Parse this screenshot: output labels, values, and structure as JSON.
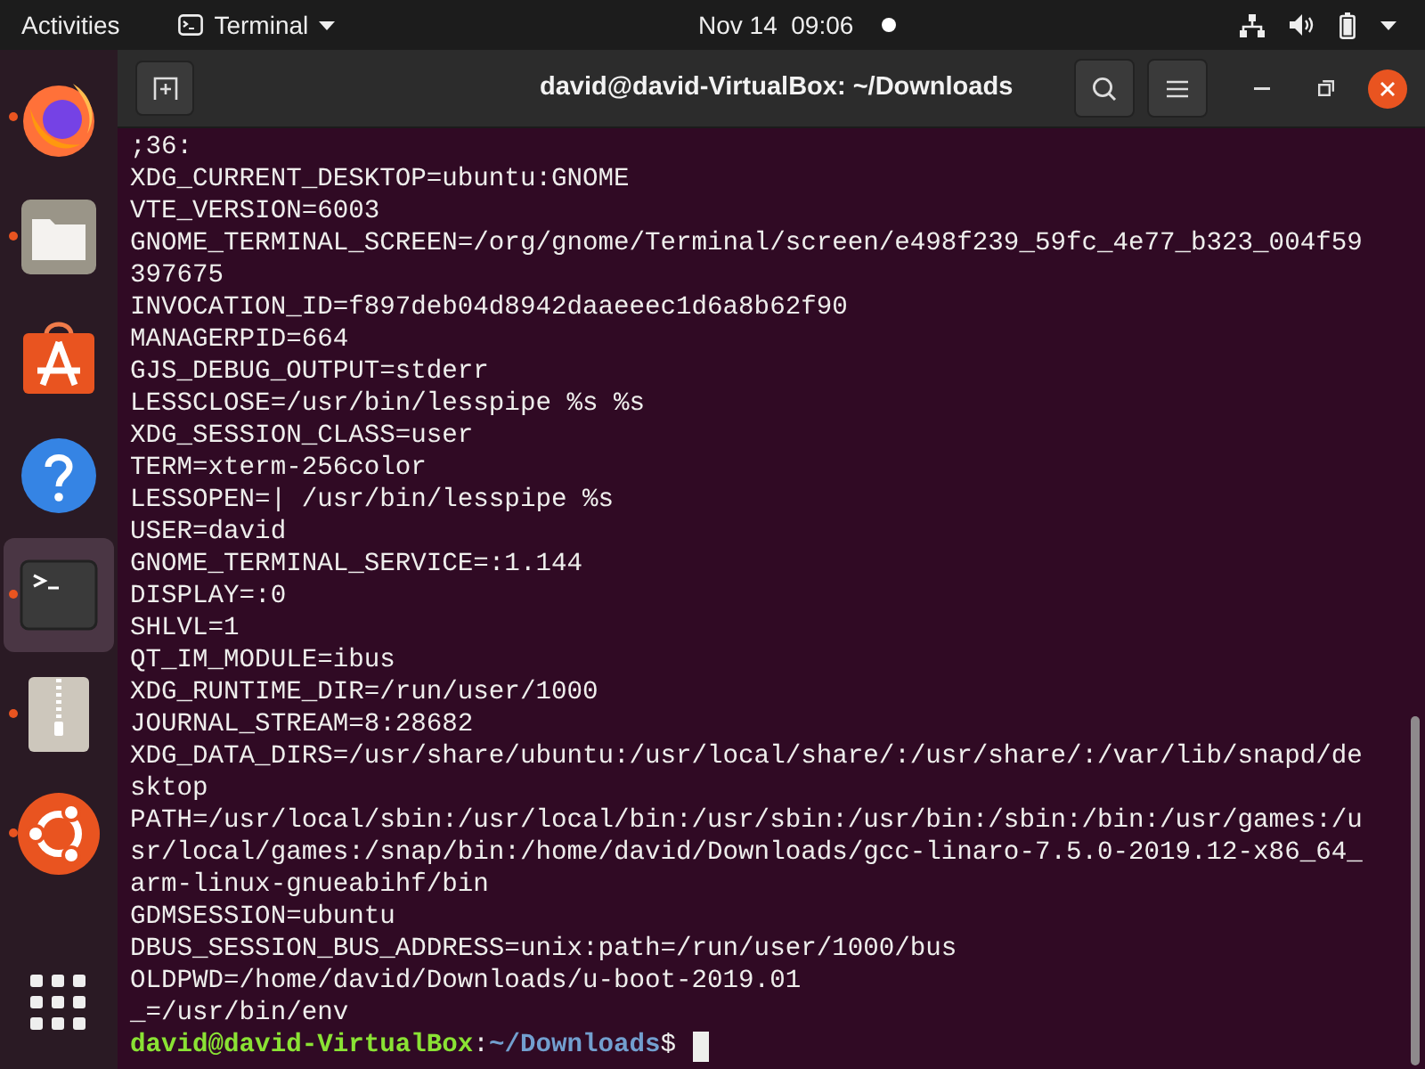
{
  "top_bar": {
    "activities": "Activities",
    "app_menu": "Terminal",
    "date": "Nov 14",
    "time": "09:06",
    "notification_dot": true
  },
  "dock": {
    "items": [
      {
        "kind": "firefox",
        "running": true,
        "selected": false
      },
      {
        "kind": "files",
        "running": true,
        "selected": false
      },
      {
        "kind": "software",
        "running": false,
        "selected": false
      },
      {
        "kind": "help",
        "running": false,
        "selected": false
      },
      {
        "kind": "terminal",
        "running": true,
        "selected": true
      },
      {
        "kind": "archive",
        "running": true,
        "selected": false
      },
      {
        "kind": "ubuntu",
        "running": true,
        "selected": false
      }
    ]
  },
  "window": {
    "title": "david@david-VirtualBox: ~/Downloads"
  },
  "terminal": {
    "lines": [
      ";36:",
      "XDG_CURRENT_DESKTOP=ubuntu:GNOME",
      "VTE_VERSION=6003",
      "GNOME_TERMINAL_SCREEN=/org/gnome/Terminal/screen/e498f239_59fc_4e77_b323_004f59",
      "397675",
      "INVOCATION_ID=f897deb04d8942daaeeec1d6a8b62f90",
      "MANAGERPID=664",
      "GJS_DEBUG_OUTPUT=stderr",
      "LESSCLOSE=/usr/bin/lesspipe %s %s",
      "XDG_SESSION_CLASS=user",
      "TERM=xterm-256color",
      "LESSOPEN=| /usr/bin/lesspipe %s",
      "USER=david",
      "GNOME_TERMINAL_SERVICE=:1.144",
      "DISPLAY=:0",
      "SHLVL=1",
      "QT_IM_MODULE=ibus",
      "XDG_RUNTIME_DIR=/run/user/1000",
      "JOURNAL_STREAM=8:28682",
      "XDG_DATA_DIRS=/usr/share/ubuntu:/usr/local/share/:/usr/share/:/var/lib/snapd/de",
      "sktop",
      "PATH=/usr/local/sbin:/usr/local/bin:/usr/sbin:/usr/bin:/sbin:/bin:/usr/games:/u",
      "sr/local/games:/snap/bin:/home/david/Downloads/gcc-linaro-7.5.0-2019.12-x86_64_",
      "arm-linux-gnueabihf/bin",
      "GDMSESSION=ubuntu",
      "DBUS_SESSION_BUS_ADDRESS=unix:path=/run/user/1000/bus",
      "OLDPWD=/home/david/Downloads/u-boot-2019.01",
      "_=/usr/bin/env"
    ],
    "prompt": {
      "user_host": "david@david-VirtualBox",
      "separator": ":",
      "path": "~/Downloads",
      "symbol": "$"
    }
  }
}
